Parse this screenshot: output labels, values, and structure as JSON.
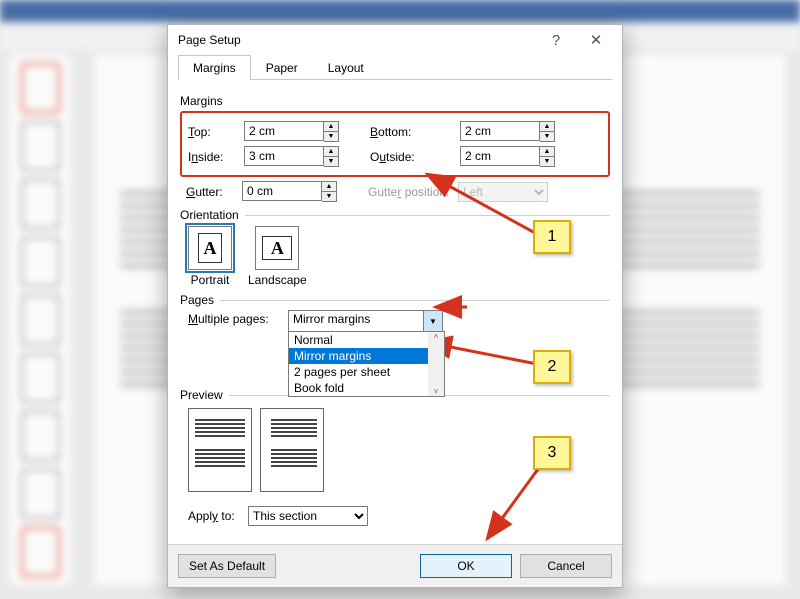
{
  "dialog": {
    "title": "Page Setup",
    "help_symbol": "?",
    "close_symbol": "✕",
    "tabs": [
      "Margins",
      "Paper",
      "Layout"
    ],
    "active_tab": 0,
    "margins": {
      "group_label": "Margins",
      "top_label": "Top:",
      "top_value": "2 cm",
      "bottom_label": "Bottom:",
      "bottom_value": "2 cm",
      "inside_label": "Inside:",
      "inside_value": "3 cm",
      "outside_label": "Outside:",
      "outside_value": "2 cm",
      "gutter_label": "Gutter:",
      "gutter_value": "0 cm",
      "gutter_pos_label": "Gutter position:",
      "gutter_pos_value": "Left"
    },
    "orientation": {
      "group_label": "Orientation",
      "portrait": "Portrait",
      "landscape": "Landscape",
      "selected": "portrait"
    },
    "pages": {
      "group_label": "Pages",
      "multiple_label": "Multiple pages:",
      "selected": "Mirror margins",
      "options": [
        "Normal",
        "Mirror margins",
        "2 pages per sheet",
        "Book fold"
      ],
      "highlighted_index": 1
    },
    "preview": {
      "group_label": "Preview"
    },
    "apply": {
      "label": "Apply to:",
      "value": "This section"
    },
    "buttons": {
      "default": "Set As Default",
      "ok": "OK",
      "cancel": "Cancel"
    }
  },
  "annotations": {
    "step1": "1",
    "step2": "2",
    "step3": "3"
  }
}
